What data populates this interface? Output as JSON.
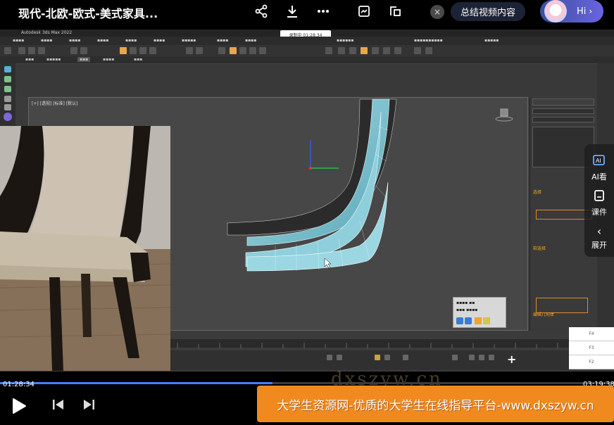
{
  "video": {
    "title": "现代-北欧-欧式-美式家具...",
    "summary_button": "总结视频内容",
    "hi_label": "Hi",
    "close_symbol": "×",
    "icons": [
      "share-icon",
      "download-icon",
      "more-icon",
      "screenshot-icon",
      "pip-icon"
    ]
  },
  "app": {
    "window_title": "Autodesk 3ds Max 2022",
    "recording_time": "录制中 01:28:34",
    "viewport_label": "[+] [透视] [标准] [默认]",
    "right_panel": {
      "selection_header": "选择",
      "soft_select": "软选择",
      "edit_geometry": "编辑几何体"
    },
    "timeline_rows": [
      "F4",
      "F3",
      "F2"
    ]
  },
  "side_panel": {
    "items": [
      {
        "label": "AI看",
        "icon": "ai-view-icon"
      },
      {
        "label": "课件",
        "icon": "courseware-icon"
      },
      {
        "label": "展开",
        "icon": "chevron-left-icon"
      }
    ]
  },
  "player": {
    "current_time": "01:28:34",
    "total_time": "03:19:38",
    "progress": 0.444,
    "banner_text": "大学生资源网-优质的大学生在线指导平台-www.dxszyw.cn",
    "watermark": "dxszyw.cn"
  }
}
